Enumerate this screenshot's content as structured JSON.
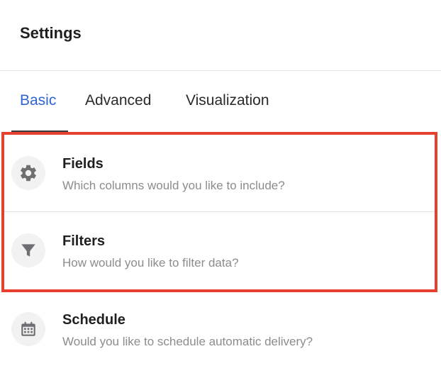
{
  "header": {
    "title": "Settings"
  },
  "tabs": [
    {
      "label": "Basic",
      "active": true
    },
    {
      "label": "Advanced",
      "active": false
    },
    {
      "label": "Visualization",
      "active": false
    }
  ],
  "items": [
    {
      "title": "Fields",
      "subtitle": "Which columns would you like to include?",
      "icon": "gear-icon"
    },
    {
      "title": "Filters",
      "subtitle": "How would you like to filter data?",
      "icon": "funnel-icon"
    },
    {
      "title": "Schedule",
      "subtitle": "Would you like to schedule automatic delivery?",
      "icon": "calendar-icon"
    }
  ],
  "colors": {
    "accent": "#2f63d6",
    "highlight_border": "#e8402f",
    "icon": "#6f6f72",
    "subtitle": "#8c8c8c"
  }
}
